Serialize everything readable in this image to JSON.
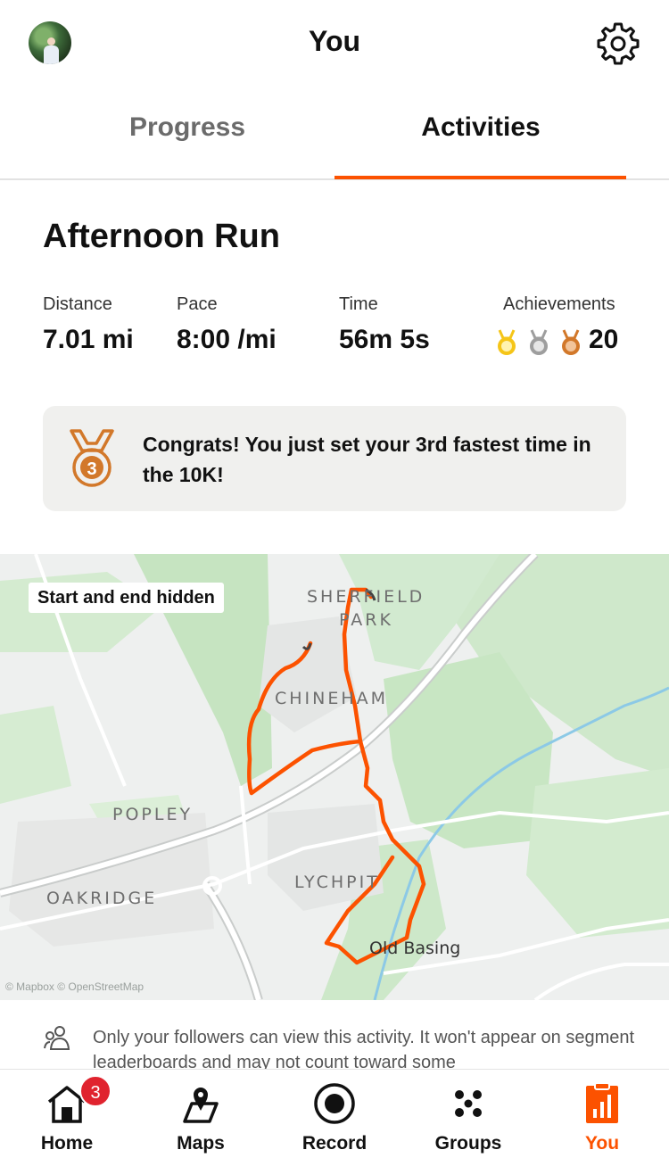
{
  "header": {
    "title": "You",
    "avatar": "avatar",
    "settings_icon": "gear-icon"
  },
  "tabs": [
    {
      "label": "Progress",
      "selected": false
    },
    {
      "label": "Activities",
      "selected": true
    }
  ],
  "activity": {
    "title": "Afternoon Run",
    "stats": [
      {
        "label": "Distance",
        "value": "7.01 mi"
      },
      {
        "label": "Pace",
        "value": "8:00 /mi"
      },
      {
        "label": "Time",
        "value": "56m 5s"
      }
    ],
    "achievements": {
      "label": "Achievements",
      "value": "20",
      "medals": [
        "gold-medal-icon",
        "silver-medal-icon",
        "bronze-medal-icon"
      ]
    },
    "congrats": {
      "message": "Congrats! You just set your 3rd fastest time in the 10K!",
      "medal_number": "3"
    }
  },
  "map": {
    "privacy_badge": "Start and end hidden",
    "places": [
      "SHERFIELD",
      "PARK",
      "CHINEHAM",
      "POPLEY",
      "LYCHPIT",
      "OAKRIDGE",
      "Old Basing"
    ],
    "attribution": "© Mapbox © OpenStreetMap",
    "route_color": "#fc5200"
  },
  "privacy_note": "Only your followers can view this activity. It won't appear on segment leaderboards and may not count toward some",
  "nav": [
    {
      "label": "Home",
      "icon": "home-icon",
      "badge": "3",
      "active": false
    },
    {
      "label": "Maps",
      "icon": "map-icon",
      "active": false
    },
    {
      "label": "Record",
      "icon": "record-icon",
      "active": false
    },
    {
      "label": "Groups",
      "icon": "groups-icon",
      "active": false
    },
    {
      "label": "You",
      "icon": "you-icon",
      "active": true
    }
  ],
  "colors": {
    "accent": "#fc5200",
    "badge": "#e0232e",
    "gold": "#f5c518",
    "silver": "#9e9e9e",
    "bronze": "#d2782a"
  }
}
